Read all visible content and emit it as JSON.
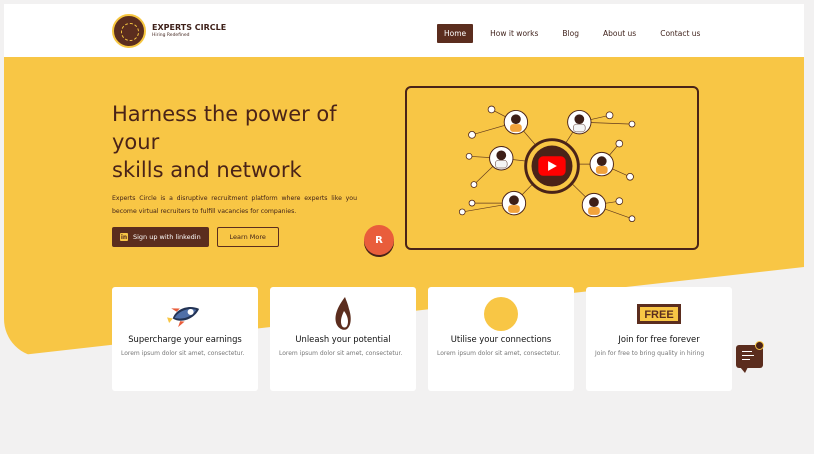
{
  "header": {
    "brand": "EXPERTS CIRCLE",
    "tagline": "Hiring Redefined",
    "nav": [
      "Home",
      "How it works",
      "Blog",
      "About us",
      "Contact us"
    ],
    "active": "Home"
  },
  "hero": {
    "title_line1": "Harness the power of your",
    "title_line2": "skills and network",
    "description": "Experts Circle is a disruptive recruitment platform where experts like you become virtual recruiters to fulfill vacancies for companies.",
    "primary_button": "Sign up with linkedin",
    "secondary_button": "Learn More",
    "badge_letter": "R"
  },
  "cards": [
    {
      "icon": "rocket-icon",
      "title": "Supercharge your earnings",
      "desc": "Lorem ipsum dolor sit amet, consectetur."
    },
    {
      "icon": "flame-icon",
      "title": "Unleash your potential",
      "desc": "Lorem ipsum dolor sit amet, consectetur."
    },
    {
      "icon": "connections-icon",
      "title": "Utilise your connections",
      "desc": "Lorem ipsum dolor sit amet, consectetur."
    },
    {
      "icon": "free-badge-icon",
      "badge": "FREE",
      "title": "Join for free forever",
      "desc": "Join for free to bring quality in hiring"
    }
  ],
  "colors": {
    "primary": "#5b2d1e",
    "accent": "#f8c645",
    "background": "#f2f1f1"
  }
}
